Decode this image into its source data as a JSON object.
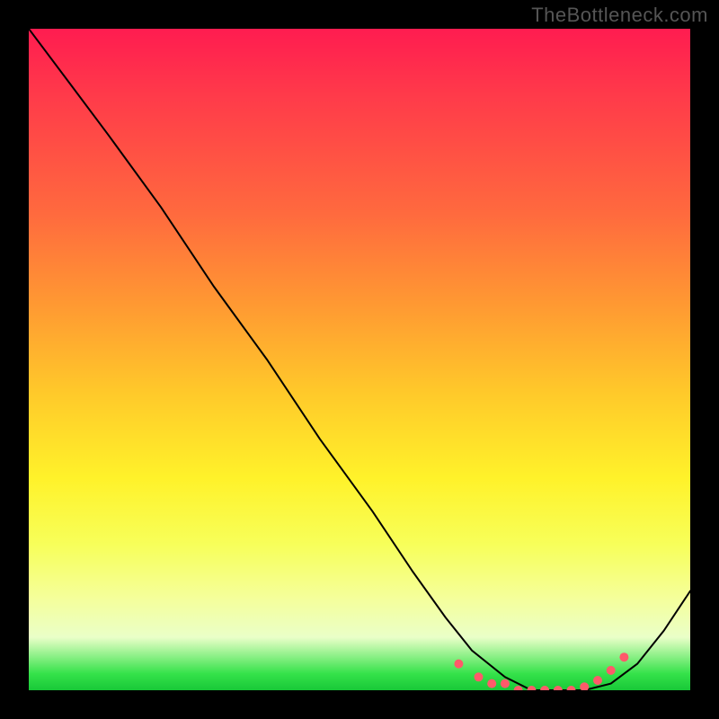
{
  "watermark": "TheBottleneck.com",
  "colors": {
    "background": "#000000",
    "curve": "#000000",
    "dots": "#ff5a6a",
    "gradient_stops": [
      "#ff1c50",
      "#ff3a4a",
      "#ff6a3e",
      "#ff9a32",
      "#ffc92a",
      "#fff22a",
      "#f7ff5a",
      "#f5ff9a",
      "#eaffc8",
      "#35e24a",
      "#18c838"
    ]
  },
  "chart_data": {
    "type": "line",
    "title": "",
    "xlabel": "",
    "ylabel": "",
    "xlim": [
      0,
      100
    ],
    "ylim": [
      0,
      100
    ],
    "grid": false,
    "legend": false,
    "series": [
      {
        "name": "curve",
        "x": [
          0,
          6,
          12,
          20,
          28,
          36,
          44,
          52,
          58,
          63,
          67,
          72,
          76,
          80,
          84,
          88,
          92,
          96,
          100
        ],
        "y": [
          100,
          92,
          84,
          73,
          61,
          50,
          38,
          27,
          18,
          11,
          6,
          2,
          0,
          0,
          0,
          1,
          4,
          9,
          15
        ]
      }
    ],
    "highlight_dots": {
      "name": "valley-dots",
      "x": [
        65,
        68,
        70,
        72,
        74,
        76,
        78,
        80,
        82,
        84,
        86,
        88,
        90
      ],
      "y": [
        4,
        2,
        1,
        1,
        0,
        0,
        0,
        0,
        0,
        0.5,
        1.5,
        3,
        5
      ]
    }
  }
}
